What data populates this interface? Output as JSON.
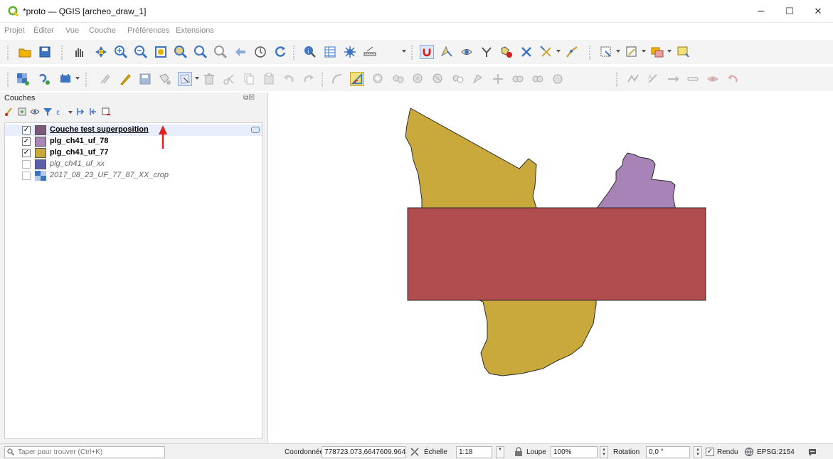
{
  "window": {
    "title": "*proto — QGIS [archeo_draw_1]",
    "minimize": "–",
    "maximize": "☐",
    "close": "✕"
  },
  "menu": [
    "Projet",
    "Éditer",
    "Vue",
    "Couche",
    "Préférences",
    "Extensions"
  ],
  "toolbar1_icons": [
    "open-project-icon",
    "save-project-icon",
    "pan-icon",
    "pan-to-selection-icon",
    "zoom-in-icon",
    "zoom-out-icon",
    "zoom-full-icon",
    "zoom-to-selection-icon",
    "zoom-to-layer-icon",
    "zoom-native-icon",
    "zoom-last-icon",
    "temporal-controller-icon",
    "refresh-icon",
    "identify-icon",
    "attribute-table-icon",
    "field-calculator-icon",
    "measure-icon",
    "snapping-magnet-icon",
    "select-feature-icon",
    "select-by-value-icon",
    "deselect-icon",
    "filter-icon",
    "clear-selection-icon",
    "digitize-shape-icon",
    "node-tool-icon",
    "select-rectangle-icon",
    "annotation-icon",
    "layer-styling-icon",
    "new-layer-icon"
  ],
  "layers_panel": {
    "title": "Couches",
    "buttons": "⧉☒",
    "layers": [
      {
        "name": "Couche test superposition",
        "checked": true,
        "color": "#7a5a78",
        "bold": true,
        "underline": true,
        "italic": false,
        "editing": true
      },
      {
        "name": "plg_ch41_uf_78",
        "checked": true,
        "color": "#a986b6",
        "bold": true,
        "underline": false,
        "italic": false,
        "editing": false
      },
      {
        "name": "plg_ch41_uf_77",
        "checked": true,
        "color": "#c8a93a",
        "bold": true,
        "underline": false,
        "italic": false,
        "editing": false
      },
      {
        "name": "plg_ch41_uf_xx",
        "checked": false,
        "color": "#5b5ea8",
        "bold": false,
        "underline": false,
        "italic": true,
        "editing": false
      },
      {
        "name": "2017_08_23_UF_77_87_XX_crop",
        "checked": false,
        "color": "raster",
        "bold": false,
        "underline": false,
        "italic": true,
        "editing": false
      }
    ]
  },
  "map_colors": {
    "yellow": "#c9a93c",
    "purple": "#a783b7",
    "red": "#b14d4f",
    "outline": "#2a2a2a"
  },
  "status": {
    "search_placeholder": "Taper pour trouver (Ctrl+K)",
    "coord_label": "Coordonnée",
    "coord_value": "778723.073,6647609.964",
    "scale_label": "Échelle",
    "scale_value": "1:18",
    "loupe_label": "Loupe",
    "loupe_value": "100%",
    "rotation_label": "Rotation",
    "rotation_value": "0,0 °",
    "render_label": "Rendu",
    "render_checked": true,
    "crs": "EPSG:2154"
  }
}
